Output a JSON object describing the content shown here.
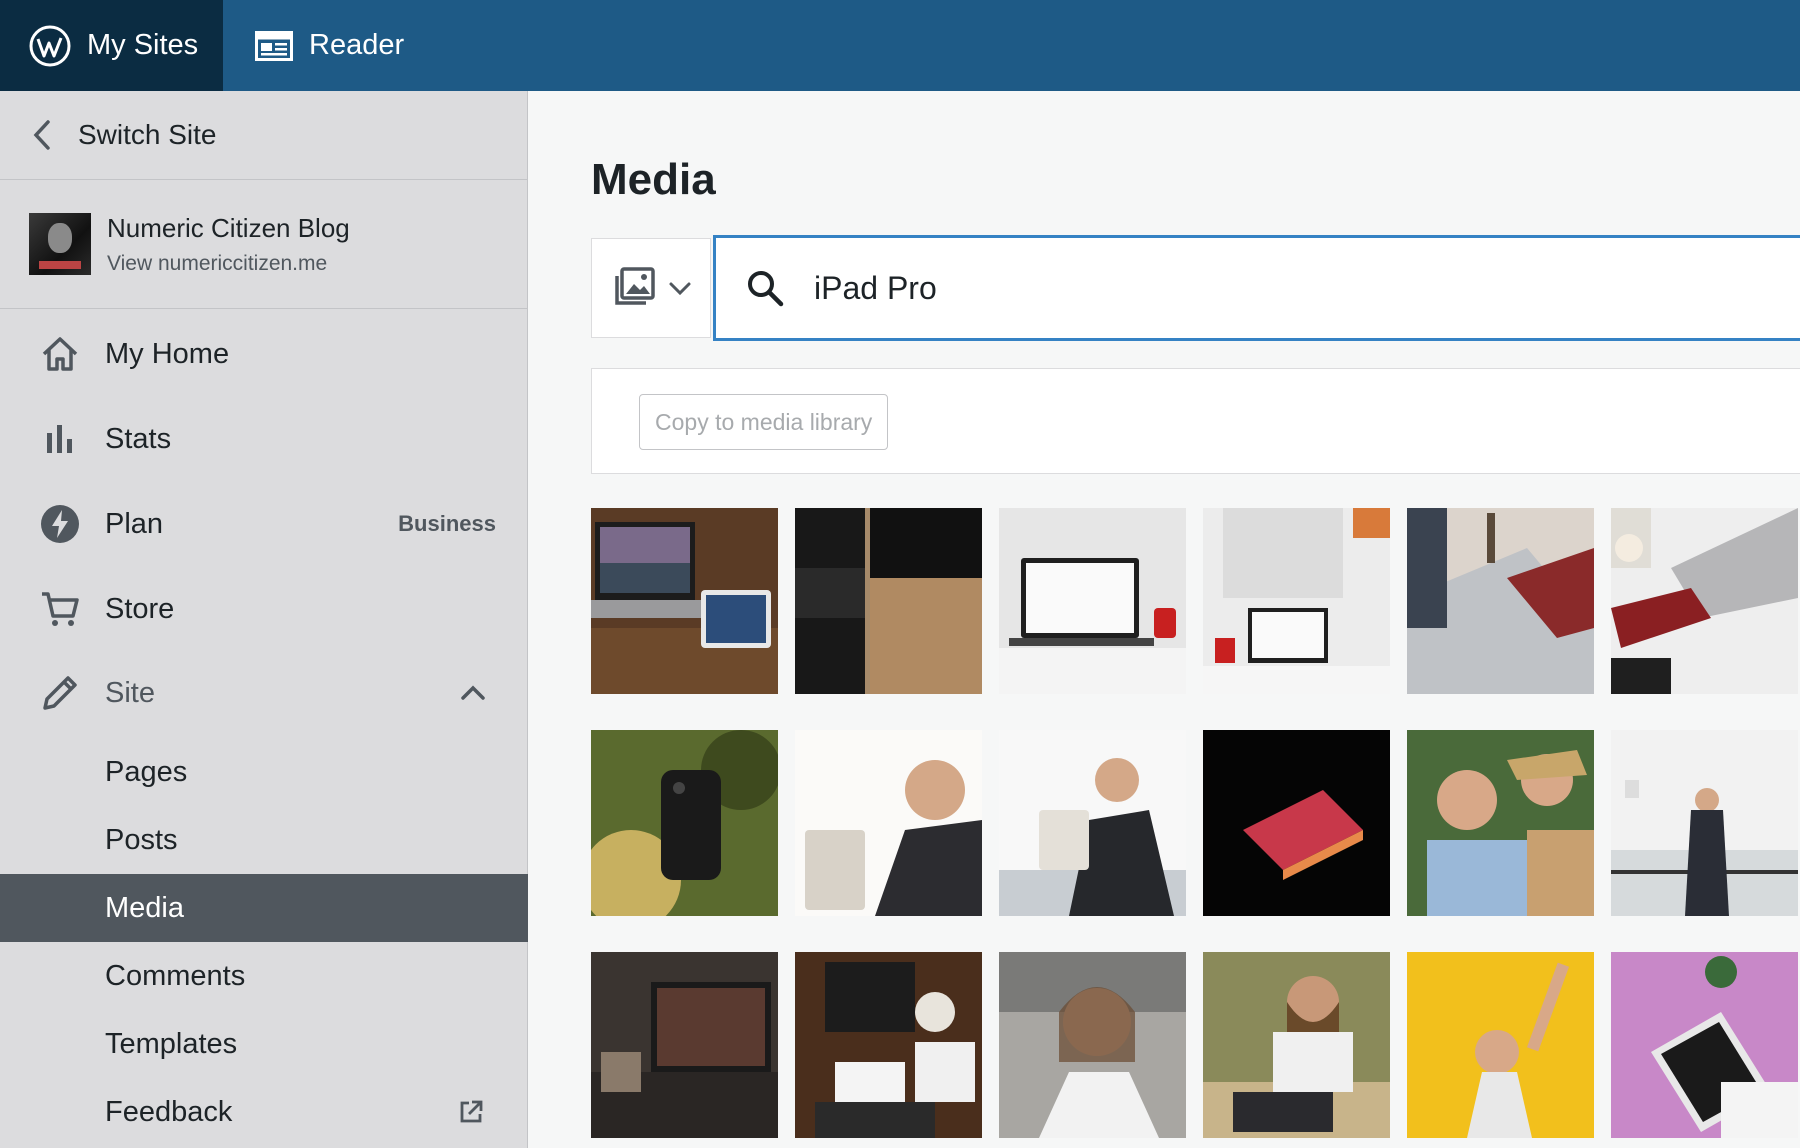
{
  "masterbar": {
    "my_sites": "My Sites",
    "reader": "Reader"
  },
  "sidebar": {
    "switch_site": "Switch Site",
    "site": {
      "title": "Numeric Citizen Blog",
      "url": "View numericcitizen.me"
    },
    "items": [
      {
        "label": "My Home",
        "icon": "home-icon"
      },
      {
        "label": "Stats",
        "icon": "stats-icon"
      },
      {
        "label": "Plan",
        "icon": "plan-icon",
        "badge": "Business"
      },
      {
        "label": "Store",
        "icon": "cart-icon"
      },
      {
        "label": "Site",
        "icon": "pencil-icon"
      }
    ],
    "site_subitems": [
      {
        "label": "Pages"
      },
      {
        "label": "Posts"
      },
      {
        "label": "Media",
        "active": true
      },
      {
        "label": "Comments"
      },
      {
        "label": "Templates"
      },
      {
        "label": "Feedback"
      }
    ]
  },
  "main": {
    "title": "Media",
    "filter_icon": "image-filter-icon",
    "search": {
      "value": "iPad Pro"
    },
    "copy_button": "Copy to media library",
    "thumbnails": [
      "laptop-and-ipad-on-desk",
      "laptop-keyboard-closeup",
      "laptop-on-white-desk",
      "pegboard-desk-laptop",
      "laptop-eiffel-tower",
      "laptop-notebook-coffee",
      "phone-in-plants",
      "man-headphones-tablet",
      "man-suit-tablet",
      "glowing-laptop-dark",
      "two-women-tablet",
      "man-arms-outstretched",
      "dark-desk-monitor",
      "overhead-desk-workspace",
      "woman-on-phone",
      "bearded-man-tablet",
      "woman-yellow-background",
      "tablet-pink-background"
    ]
  },
  "colors": {
    "masterbar": "#1e5a86",
    "my_sites_bg": "#0b2c42",
    "sidebar_bg": "#dcdcde",
    "active_item": "#50575e",
    "search_border": "#3582c4"
  }
}
